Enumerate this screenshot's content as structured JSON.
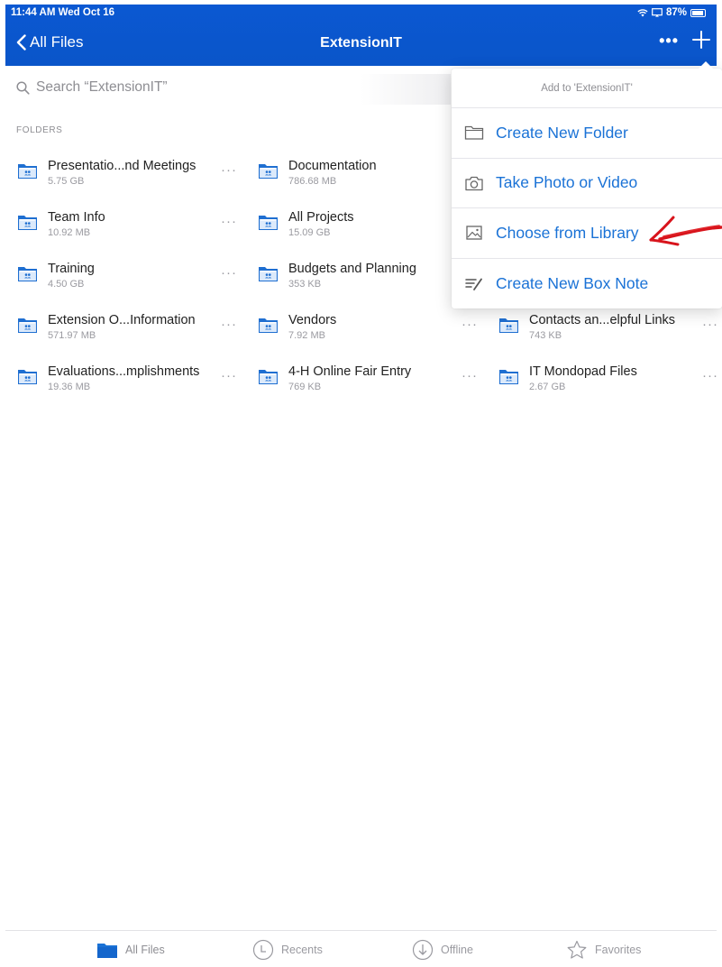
{
  "status_bar": {
    "time": "11:44 AM  Wed Oct 16",
    "battery": "87%"
  },
  "nav": {
    "back_label": "All Files",
    "title": "ExtensionIT",
    "more_label": "•••"
  },
  "search": {
    "placeholder": "Search “ExtensionIT”"
  },
  "section_label": "FOLDERS",
  "folders": [
    {
      "name": "Presentatio...nd Meetings",
      "size": "5.75 GB"
    },
    {
      "name": "Documentation",
      "size": "786.68 MB"
    },
    {
      "name": "Team Info",
      "size": "10.92 MB"
    },
    {
      "name": "All Projects",
      "size": "15.09 GB"
    },
    {
      "name": "Training",
      "size": "4.50 GB"
    },
    {
      "name": "Budgets and Planning",
      "size": "353 KB"
    },
    {
      "name": "Extension O...Information",
      "size": "571.97 MB"
    },
    {
      "name": "Vendors",
      "size": "7.92 MB"
    },
    {
      "name": "Contacts an...elpful Links",
      "size": "743 KB"
    },
    {
      "name": "Evaluations...mplishments",
      "size": "19.36 MB"
    },
    {
      "name": "4-H Online   Fair Entry",
      "size": "769 KB"
    },
    {
      "name": "IT Mondopad Files",
      "size": "2.67 GB"
    }
  ],
  "popover": {
    "header": "Add to 'ExtensionIT'",
    "items": [
      {
        "label": "Create New Folder",
        "icon": "folder-outline-icon"
      },
      {
        "label": "Take Photo or Video",
        "icon": "camera-icon"
      },
      {
        "label": "Choose from Library",
        "icon": "image-icon"
      },
      {
        "label": "Create New Box Note",
        "icon": "note-pen-icon"
      }
    ]
  },
  "tabs": [
    {
      "label": "All Files",
      "icon": "folder-filled-icon",
      "active": true
    },
    {
      "label": "Recents",
      "icon": "clock-icon",
      "active": false
    },
    {
      "label": "Offline",
      "icon": "download-circle-icon",
      "active": false
    },
    {
      "label": "Favorites",
      "icon": "star-icon",
      "active": false
    }
  ],
  "colors": {
    "header_blue": "#0a57cd",
    "accent_blue": "#1a72d6",
    "folder_blue": "#1f6fd1",
    "annotation_red": "#d8141c"
  }
}
